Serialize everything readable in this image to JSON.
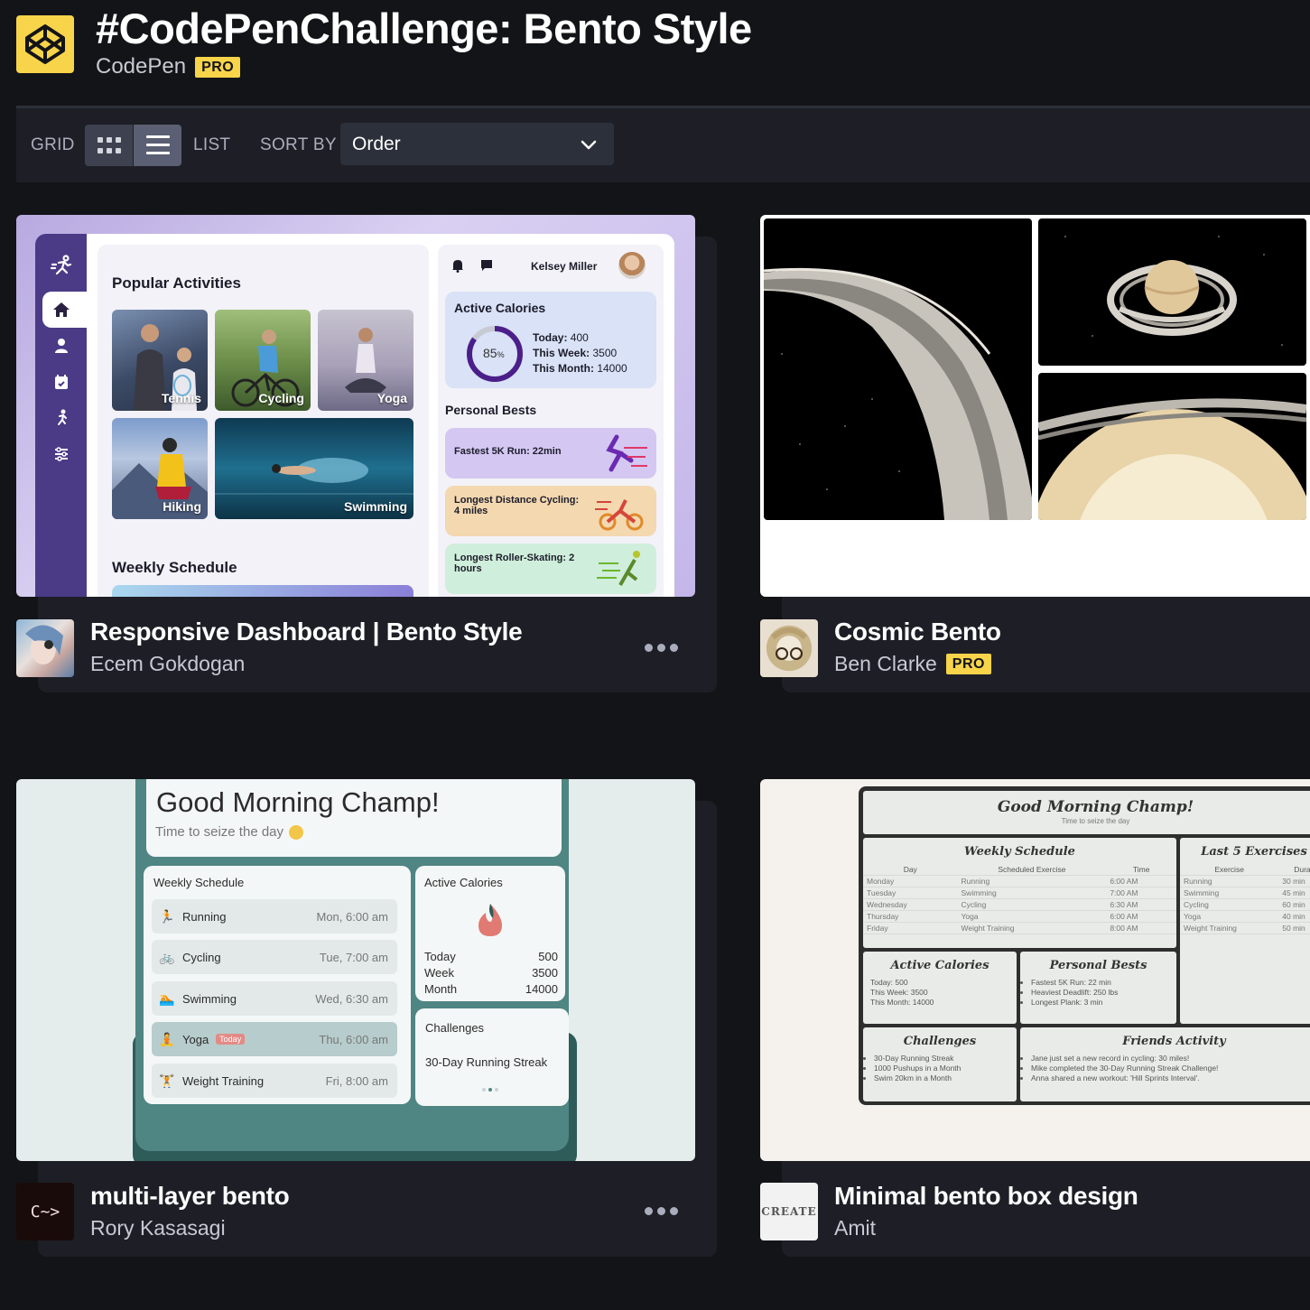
{
  "header": {
    "title": "#CodePenChallenge: Bento Style",
    "owner": "CodePen",
    "badge": "PRO"
  },
  "toolbar": {
    "grid_label": "GRID",
    "list_label": "LIST",
    "sort_label": "SORT BY",
    "sort_value": "Order"
  },
  "cards": [
    {
      "title": "Responsive Dashboard | Bento Style",
      "author": "Ecem Gokdogan",
      "preview": {
        "popular_heading": "Popular Activities",
        "activities": [
          "Tennis",
          "Cycling",
          "Yoga",
          "Hiking",
          "Swimming"
        ],
        "weekly_heading": "Weekly Schedule",
        "user_name": "Kelsey Miller",
        "calories_heading": "Active Calories",
        "calories_percent": "85",
        "percent_unit": "%",
        "today_label": "Today:",
        "today_value": "400",
        "week_label": "This Week:",
        "week_value": "3500",
        "month_label": "This Month:",
        "month_value": "14000",
        "bests_heading": "Personal Bests",
        "bests": [
          "Fastest 5K Run: 22min",
          "Longest Distance Cycling: 4 miles",
          "Longest Roller-Skating: 2 hours"
        ]
      }
    },
    {
      "title": "Cosmic Bento",
      "author": "Ben Clarke",
      "badge": "PRO"
    },
    {
      "title": "multi-layer bento",
      "author": "Rory Kasasagi",
      "avatar_text": "C~>",
      "preview": {
        "greeting": "Good Morning Champ!",
        "subgreeting": "Time to seize the day",
        "weekly_heading": "Weekly Schedule",
        "schedule": [
          {
            "name": "Running",
            "time": "Mon, 6:00 am"
          },
          {
            "name": "Cycling",
            "time": "Tue, 7:00 am"
          },
          {
            "name": "Swimming",
            "time": "Wed, 6:30 am"
          },
          {
            "name": "Yoga",
            "time": "Thu, 6:00 am",
            "tag": "Today"
          },
          {
            "name": "Weight Training",
            "time": "Fri, 8:00 am"
          }
        ],
        "calories_heading": "Active Calories",
        "cal_rows": [
          {
            "label": "Today",
            "value": "500"
          },
          {
            "label": "Week",
            "value": "3500"
          },
          {
            "label": "Month",
            "value": "14000"
          }
        ],
        "challenges_heading": "Challenges",
        "challenge": "30-Day Running Streak"
      }
    },
    {
      "title": "Minimal bento box design",
      "author": "Amit",
      "avatar_text": "CREATE",
      "preview": {
        "greeting": "Good Morning Champ!",
        "subgreeting": "Time to seize the day",
        "weekly_heading": "Weekly Schedule",
        "cols": [
          "Day",
          "Scheduled Exercise",
          "Time"
        ],
        "rows": [
          [
            "Monday",
            "Running",
            "6:00 AM"
          ],
          [
            "Tuesday",
            "Swimming",
            "7:00 AM"
          ],
          [
            "Wednesday",
            "Cycling",
            "6:30 AM"
          ],
          [
            "Thursday",
            "Yoga",
            "6:00 AM"
          ],
          [
            "Friday",
            "Weight Training",
            "8:00 AM"
          ]
        ],
        "last5_heading": "Last 5 Exercises",
        "last5_cols": [
          "Exercise",
          "Durat"
        ],
        "last5_rows": [
          [
            "Running",
            "30 min"
          ],
          [
            "Swimming",
            "45 min"
          ],
          [
            "Cycling",
            "60 min"
          ],
          [
            "Yoga",
            "40 min"
          ],
          [
            "Weight Training",
            "50 min"
          ]
        ],
        "calories_heading": "Active Calories",
        "cal_today": "Today: 500",
        "cal_week": "This Week: 3500",
        "cal_month": "This Month: 14000",
        "bests_heading": "Personal Bests",
        "bests": [
          "Fastest 5K Run: 22 min",
          "Heaviest Deadlift: 250 lbs",
          "Longest Plank: 3 min"
        ],
        "challenges_heading": "Challenges",
        "challenges": [
          "30-Day Running Streak",
          "1000 Pushups in a Month",
          "Swim 20km in a Month"
        ],
        "friends_heading": "Friends Activity",
        "friends": [
          "Jane just set a new record in cycling: 30 miles!",
          "Mike completed the 30-Day Running Streak Challenge!",
          "Anna shared a new workout: 'Hill Sprints Interval'."
        ]
      }
    }
  ]
}
